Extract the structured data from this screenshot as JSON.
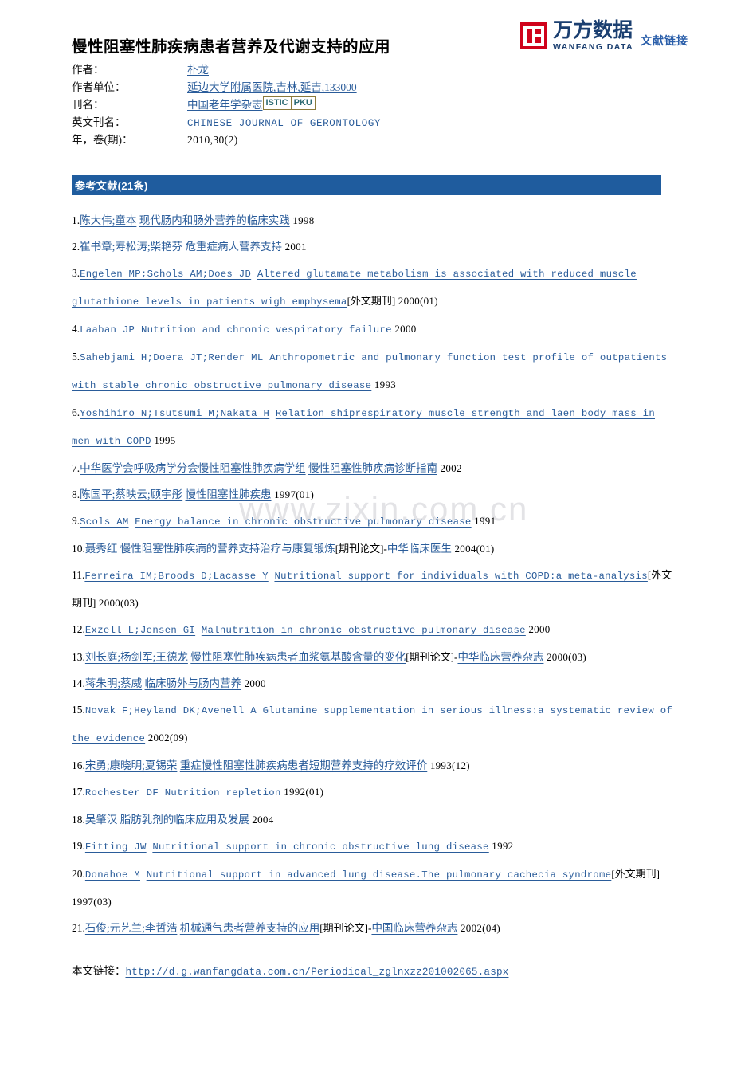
{
  "logo": {
    "mark": "wanfang-square-logo",
    "cn_name": "万方数据",
    "en_name": "WANFANG DATA",
    "side_label": "文献链接"
  },
  "title": "慢性阻塞性肺疾病患者营养及代谢支持的应用",
  "meta": [
    {
      "label": "作者：",
      "value": "朴龙",
      "link": true,
      "style": "cn"
    },
    {
      "label": "作者单位：",
      "value": "延边大学附属医院,吉林,延吉,133000",
      "link": true,
      "style": "cn"
    },
    {
      "label": "刊名：",
      "value": "中国老年学杂志",
      "link": true,
      "style": "cn",
      "badges": [
        "ISTIC",
        "PKU"
      ]
    },
    {
      "label": "英文刊名：",
      "value": "CHINESE JOURNAL OF GERONTOLOGY",
      "link": true,
      "style": "en"
    },
    {
      "label": "年，卷(期)：",
      "value": "2010,30(2)",
      "link": false,
      "style": "num"
    }
  ],
  "section": {
    "title": "参考文献(21条)",
    "bar_color": "#1f5c9e"
  },
  "watermark": "www.zixin.com.cn",
  "references": [
    {
      "index": "1.",
      "parts": [
        {
          "t": "陈大伟;童本",
          "link": true,
          "style": "cn"
        },
        {
          "t": " ",
          "link": false,
          "style": "cn"
        },
        {
          "t": "现代肠内和肠外营养的临床实践",
          "link": true,
          "style": "cn"
        },
        {
          "t": "  1998",
          "link": false,
          "style": "yr"
        }
      ]
    },
    {
      "index": "2.",
      "parts": [
        {
          "t": "崔书章;寿松涛;柴艳芬",
          "link": true,
          "style": "cn"
        },
        {
          "t": " ",
          "link": false,
          "style": "cn"
        },
        {
          "t": "危重症病人营养支持",
          "link": true,
          "style": "cn"
        },
        {
          "t": "  2001",
          "link": false,
          "style": "yr"
        }
      ]
    },
    {
      "index": "3.",
      "parts": [
        {
          "t": "Engelen MP;Schols AM;Does JD",
          "link": true,
          "style": "en"
        },
        {
          "t": " ",
          "link": false,
          "style": "en"
        },
        {
          "t": "Altered glutamate metabolism is associated with reduced muscle glutathione levels in patients wigh emphysema",
          "link": true,
          "style": "en"
        },
        {
          "t": "[外文期刊]",
          "link": false,
          "style": "tag"
        },
        {
          "t": "  2000(01)",
          "link": false,
          "style": "yr"
        }
      ]
    },
    {
      "index": "4.",
      "parts": [
        {
          "t": "Laaban JP",
          "link": true,
          "style": "en"
        },
        {
          "t": " ",
          "link": false,
          "style": "en"
        },
        {
          "t": "Nutrition and chronic vespiratory failure",
          "link": true,
          "style": "en"
        },
        {
          "t": "  2000",
          "link": false,
          "style": "yr"
        }
      ]
    },
    {
      "index": "5.",
      "parts": [
        {
          "t": "Sahebjami H;Doera JT;Render ML",
          "link": true,
          "style": "en"
        },
        {
          "t": " ",
          "link": false,
          "style": "en"
        },
        {
          "t": "Anthropometric and pulmonary function test profile of outpatients with stable chronic obstructive pulmonary disease",
          "link": true,
          "style": "en"
        },
        {
          "t": "  1993",
          "link": false,
          "style": "yr"
        }
      ]
    },
    {
      "index": "6.",
      "parts": [
        {
          "t": "Yoshihiro N;Tsutsumi M;Nakata H",
          "link": true,
          "style": "en"
        },
        {
          "t": " ",
          "link": false,
          "style": "en"
        },
        {
          "t": "Relation shiprespiratory muscle strength and laen body mass in men with COPD",
          "link": true,
          "style": "en"
        },
        {
          "t": "  1995",
          "link": false,
          "style": "yr"
        }
      ]
    },
    {
      "index": "7.",
      "parts": [
        {
          "t": "中华医学会呼吸病学分会慢性阻塞性肺疾病学组",
          "link": true,
          "style": "cn"
        },
        {
          "t": " ",
          "link": false,
          "style": "cn"
        },
        {
          "t": "慢性阻塞性肺疾病诊断指南",
          "link": true,
          "style": "cn"
        },
        {
          "t": "  2002",
          "link": false,
          "style": "yr"
        }
      ]
    },
    {
      "index": "8.",
      "parts": [
        {
          "t": "陈国平;蔡映云;顾宇彤",
          "link": true,
          "style": "cn"
        },
        {
          "t": " ",
          "link": false,
          "style": "cn"
        },
        {
          "t": "慢性阻塞性肺疾患",
          "link": true,
          "style": "cn"
        },
        {
          "t": "  1997(01)",
          "link": false,
          "style": "yr"
        }
      ]
    },
    {
      "index": "9.",
      "parts": [
        {
          "t": "Scols AM",
          "link": true,
          "style": "en"
        },
        {
          "t": " ",
          "link": false,
          "style": "en"
        },
        {
          "t": "Energy balance in chronic obstructive pulmonary disease",
          "link": true,
          "style": "en"
        },
        {
          "t": "  1991",
          "link": false,
          "style": "yr"
        }
      ]
    },
    {
      "index": "10.",
      "parts": [
        {
          "t": "聂秀红",
          "link": true,
          "style": "cn"
        },
        {
          "t": " ",
          "link": false,
          "style": "cn"
        },
        {
          "t": "慢性阻塞性肺疾病的营养支持治疗与康复锻炼",
          "link": true,
          "style": "cn"
        },
        {
          "t": "[期刊论文]",
          "link": false,
          "style": "tag"
        },
        {
          "t": "-",
          "link": false,
          "style": "sep"
        },
        {
          "t": "中华临床医生",
          "link": true,
          "style": "cn"
        },
        {
          "t": "  2004(01)",
          "link": false,
          "style": "yr"
        }
      ]
    },
    {
      "index": "11.",
      "parts": [
        {
          "t": "Ferreira IM;Broods D;Lacasse Y",
          "link": true,
          "style": "en"
        },
        {
          "t": " ",
          "link": false,
          "style": "en"
        },
        {
          "t": "Nutritional support for individuals with COPD:a meta-analysis",
          "link": true,
          "style": "en"
        },
        {
          "t": "[外文期刊]",
          "link": false,
          "style": "tag"
        },
        {
          "t": "  2000(03)",
          "link": false,
          "style": "yr"
        }
      ]
    },
    {
      "index": "12.",
      "parts": [
        {
          "t": "Exzell L;Jensen GI",
          "link": true,
          "style": "en"
        },
        {
          "t": " ",
          "link": false,
          "style": "en"
        },
        {
          "t": "Malnutrition in chronic obstructive pulmonary disease",
          "link": true,
          "style": "en"
        },
        {
          "t": "  2000",
          "link": false,
          "style": "yr"
        }
      ]
    },
    {
      "index": "13.",
      "parts": [
        {
          "t": "刘长庭;杨剑军;王德龙",
          "link": true,
          "style": "cn"
        },
        {
          "t": " ",
          "link": false,
          "style": "cn"
        },
        {
          "t": "慢性阻塞性肺疾病患者血浆氨基酸含量的变化",
          "link": true,
          "style": "cn"
        },
        {
          "t": "[期刊论文]",
          "link": false,
          "style": "tag"
        },
        {
          "t": "-",
          "link": false,
          "style": "sep"
        },
        {
          "t": "中华临床营养杂志",
          "link": true,
          "style": "cn"
        },
        {
          "t": "  2000(03)",
          "link": false,
          "style": "yr"
        }
      ]
    },
    {
      "index": "14.",
      "parts": [
        {
          "t": "蒋朱明;蔡威",
          "link": true,
          "style": "cn"
        },
        {
          "t": " ",
          "link": false,
          "style": "cn"
        },
        {
          "t": "临床肠外与肠内营养",
          "link": true,
          "style": "cn"
        },
        {
          "t": "  2000",
          "link": false,
          "style": "yr"
        }
      ]
    },
    {
      "index": "15.",
      "parts": [
        {
          "t": "Novak F;Heyland DK;Avenell A",
          "link": true,
          "style": "en"
        },
        {
          "t": " ",
          "link": false,
          "style": "en"
        },
        {
          "t": "Glutamine supplementation in serious illness:a systematic review of the evidence",
          "link": true,
          "style": "en"
        },
        {
          "t": "  2002(09)",
          "link": false,
          "style": "yr"
        }
      ]
    },
    {
      "index": "16.",
      "parts": [
        {
          "t": "宋勇;康晓明;夏锡荣",
          "link": true,
          "style": "cn"
        },
        {
          "t": " ",
          "link": false,
          "style": "cn"
        },
        {
          "t": "重症慢性阻塞性肺疾病患者短期营养支持的疗效评价",
          "link": true,
          "style": "cn"
        },
        {
          "t": "  1993(12)",
          "link": false,
          "style": "yr"
        }
      ]
    },
    {
      "index": "17.",
      "parts": [
        {
          "t": "Rochester DF",
          "link": true,
          "style": "en"
        },
        {
          "t": " ",
          "link": false,
          "style": "en"
        },
        {
          "t": "Nutrition repletion",
          "link": true,
          "style": "en"
        },
        {
          "t": "  1992(01)",
          "link": false,
          "style": "yr"
        }
      ]
    },
    {
      "index": "18.",
      "parts": [
        {
          "t": "吴肇汉",
          "link": true,
          "style": "cn"
        },
        {
          "t": " ",
          "link": false,
          "style": "cn"
        },
        {
          "t": "脂肪乳剂的临床应用及发展",
          "link": true,
          "style": "cn"
        },
        {
          "t": "  2004",
          "link": false,
          "style": "yr"
        }
      ]
    },
    {
      "index": "19.",
      "parts": [
        {
          "t": "Fitting JW",
          "link": true,
          "style": "en"
        },
        {
          "t": " ",
          "link": false,
          "style": "en"
        },
        {
          "t": "Nutritional support in chronic obstructive lung disease",
          "link": true,
          "style": "en"
        },
        {
          "t": "  1992",
          "link": false,
          "style": "yr"
        }
      ]
    },
    {
      "index": "20.",
      "parts": [
        {
          "t": "Donahoe M",
          "link": true,
          "style": "en"
        },
        {
          "t": " ",
          "link": false,
          "style": "en"
        },
        {
          "t": "Nutritional support in advanced lung disease.The pulmonary cachecia syndrome",
          "link": true,
          "style": "en"
        },
        {
          "t": "[外文期刊]",
          "link": false,
          "style": "tag"
        },
        {
          "t": "  1997(03)",
          "link": false,
          "style": "yr"
        }
      ]
    },
    {
      "index": "21.",
      "parts": [
        {
          "t": "石俊;元艺兰;李哲浩",
          "link": true,
          "style": "cn"
        },
        {
          "t": " ",
          "link": false,
          "style": "cn"
        },
        {
          "t": "机械通气患者营养支持的应用",
          "link": true,
          "style": "cn"
        },
        {
          "t": "[期刊论文]",
          "link": false,
          "style": "tag"
        },
        {
          "t": "-",
          "link": false,
          "style": "sep"
        },
        {
          "t": "中国临床营养杂志",
          "link": true,
          "style": "cn"
        },
        {
          "t": "  2002(04)",
          "link": false,
          "style": "yr"
        }
      ]
    }
  ],
  "footer": {
    "label": "本文链接：",
    "url": "http://d.g.wanfangdata.com.cn/Periodical_zglnxzz201002065.aspx"
  }
}
